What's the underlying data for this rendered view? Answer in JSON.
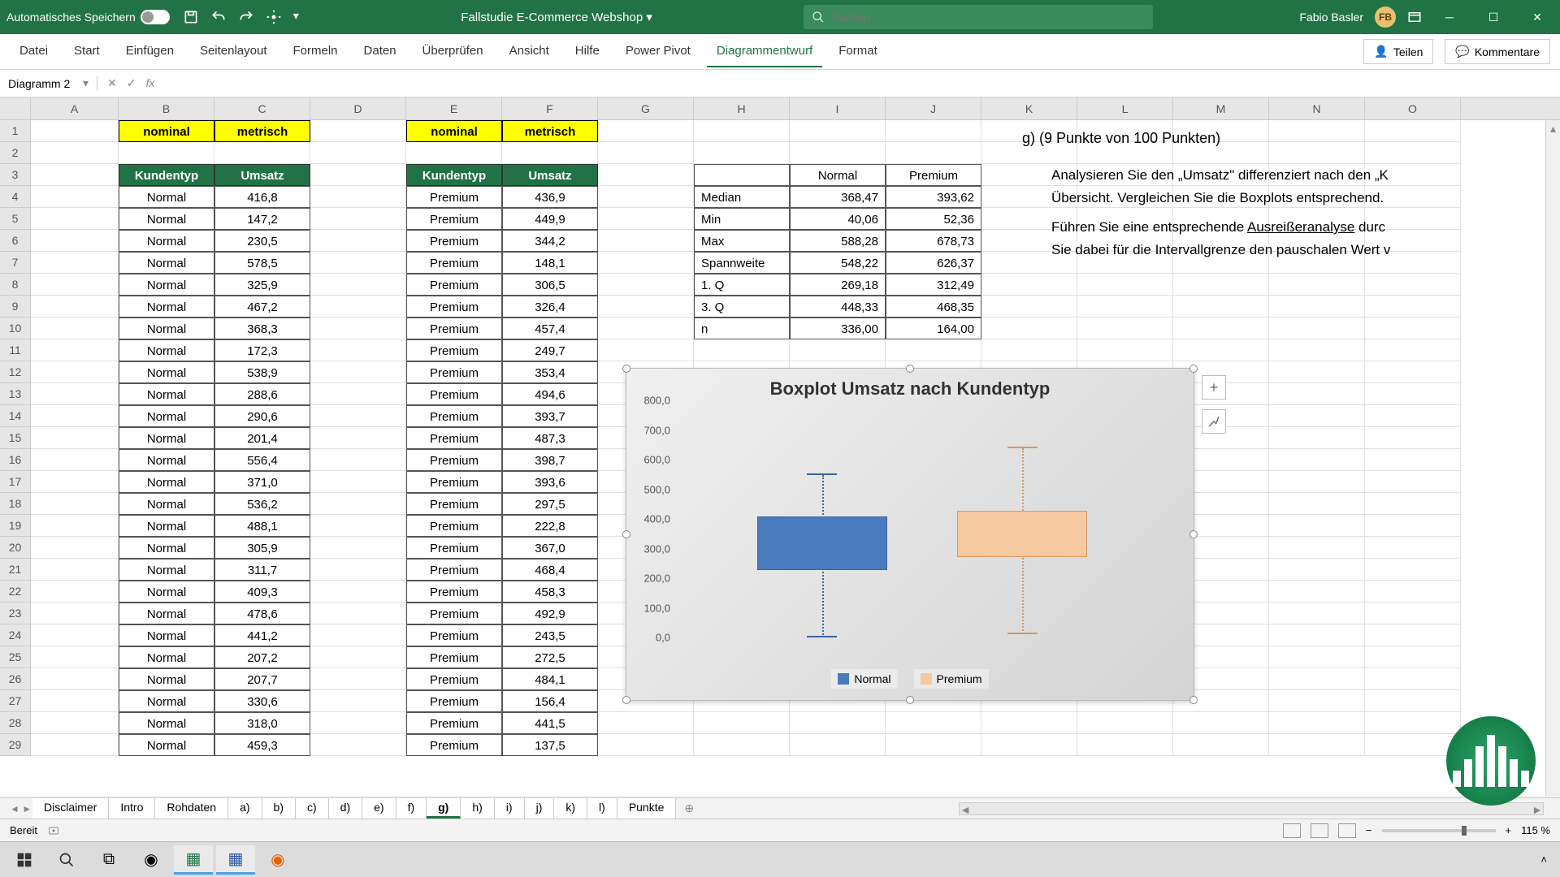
{
  "titlebar": {
    "autosave": "Automatisches Speichern",
    "doc_title": "Fallstudie E-Commerce Webshop",
    "search_placeholder": "Suchen",
    "user_name": "Fabio Basler",
    "user_initials": "FB"
  },
  "ribbon": {
    "tabs": [
      "Datei",
      "Start",
      "Einfügen",
      "Seitenlayout",
      "Formeln",
      "Daten",
      "Überprüfen",
      "Ansicht",
      "Hilfe",
      "Power Pivot",
      "Diagrammentwurf",
      "Format"
    ],
    "share": "Teilen",
    "comments": "Kommentare"
  },
  "namebox": "Diagramm 2",
  "headers": {
    "nominal": "nominal",
    "metrisch": "metrisch",
    "kundentyp": "Kundentyp",
    "umsatz": "Umsatz"
  },
  "table1": [
    [
      "Normal",
      "416,8"
    ],
    [
      "Normal",
      "147,2"
    ],
    [
      "Normal",
      "230,5"
    ],
    [
      "Normal",
      "578,5"
    ],
    [
      "Normal",
      "325,9"
    ],
    [
      "Normal",
      "467,2"
    ],
    [
      "Normal",
      "368,3"
    ],
    [
      "Normal",
      "172,3"
    ],
    [
      "Normal",
      "538,9"
    ],
    [
      "Normal",
      "288,6"
    ],
    [
      "Normal",
      "290,6"
    ],
    [
      "Normal",
      "201,4"
    ],
    [
      "Normal",
      "556,4"
    ],
    [
      "Normal",
      "371,0"
    ],
    [
      "Normal",
      "536,2"
    ],
    [
      "Normal",
      "488,1"
    ],
    [
      "Normal",
      "305,9"
    ],
    [
      "Normal",
      "311,7"
    ],
    [
      "Normal",
      "409,3"
    ],
    [
      "Normal",
      "478,6"
    ],
    [
      "Normal",
      "441,2"
    ],
    [
      "Normal",
      "207,2"
    ],
    [
      "Normal",
      "207,7"
    ],
    [
      "Normal",
      "330,6"
    ],
    [
      "Normal",
      "318,0"
    ],
    [
      "Normal",
      "459,3"
    ]
  ],
  "table2": [
    [
      "Premium",
      "436,9"
    ],
    [
      "Premium",
      "449,9"
    ],
    [
      "Premium",
      "344,2"
    ],
    [
      "Premium",
      "148,1"
    ],
    [
      "Premium",
      "306,5"
    ],
    [
      "Premium",
      "326,4"
    ],
    [
      "Premium",
      "457,4"
    ],
    [
      "Premium",
      "249,7"
    ],
    [
      "Premium",
      "353,4"
    ],
    [
      "Premium",
      "494,6"
    ],
    [
      "Premium",
      "393,7"
    ],
    [
      "Premium",
      "487,3"
    ],
    [
      "Premium",
      "398,7"
    ],
    [
      "Premium",
      "393,6"
    ],
    [
      "Premium",
      "297,5"
    ],
    [
      "Premium",
      "222,8"
    ],
    [
      "Premium",
      "367,0"
    ],
    [
      "Premium",
      "468,4"
    ],
    [
      "Premium",
      "458,3"
    ],
    [
      "Premium",
      "492,9"
    ],
    [
      "Premium",
      "243,5"
    ],
    [
      "Premium",
      "272,5"
    ],
    [
      "Premium",
      "484,1"
    ],
    [
      "Premium",
      "156,4"
    ],
    [
      "Premium",
      "441,5"
    ],
    [
      "Premium",
      "137,5"
    ]
  ],
  "stats": {
    "cols": [
      "Normal",
      "Premium"
    ],
    "rows": [
      [
        "Median",
        "368,47",
        "393,62"
      ],
      [
        "Min",
        "40,06",
        "52,36"
      ],
      [
        "Max",
        "588,28",
        "678,73"
      ],
      [
        "Spannweite",
        "548,22",
        "626,37"
      ],
      [
        "1. Q",
        "269,18",
        "312,49"
      ],
      [
        "3. Q",
        "448,33",
        "468,35"
      ],
      [
        "n",
        "336,00",
        "164,00"
      ]
    ]
  },
  "task_text": {
    "heading": "g) (9 Punkte von 100 Punkten)",
    "p1a": "Analysieren Sie den „Umsatz\" differenziert nach den „K",
    "p1b": "Übersicht. Vergleichen Sie die Boxplots entsprechend.",
    "p2a": "Führen Sie eine entsprechende ",
    "p2u": "Ausreißeranalyse",
    "p2b": " durc",
    "p2c": "Sie dabei für die Intervallgrenze den pauschalen Wert v"
  },
  "chart_data": {
    "type": "boxplot",
    "title": "Boxplot Umsatz nach Kundentyp",
    "ylabel": "",
    "ylim": [
      0,
      800
    ],
    "yticks": [
      "0,0",
      "100,0",
      "200,0",
      "300,0",
      "400,0",
      "500,0",
      "600,0",
      "700,0",
      "800,0"
    ],
    "series": [
      {
        "name": "Normal",
        "min": 40.06,
        "q1": 269.18,
        "median": 368.47,
        "q3": 448.33,
        "max": 588.28,
        "color": "#4a7bbf"
      },
      {
        "name": "Premium",
        "min": 52.36,
        "q1": 312.49,
        "median": 393.62,
        "q3": 468.35,
        "max": 678.73,
        "color": "#f7c9a0"
      }
    ],
    "legend": [
      "Normal",
      "Premium"
    ]
  },
  "sheet_tabs": [
    "Disclaimer",
    "Intro",
    "Rohdaten",
    "a)",
    "b)",
    "c)",
    "d)",
    "e)",
    "f)",
    "g)",
    "h)",
    "i)",
    "j)",
    "k)",
    "l)",
    "Punkte"
  ],
  "active_sheet": "g)",
  "status": {
    "ready": "Bereit",
    "zoom": "115 %"
  },
  "col_letters": [
    "A",
    "B",
    "C",
    "D",
    "E",
    "F",
    "G",
    "H",
    "I",
    "J",
    "K",
    "L",
    "M",
    "N",
    "O"
  ]
}
